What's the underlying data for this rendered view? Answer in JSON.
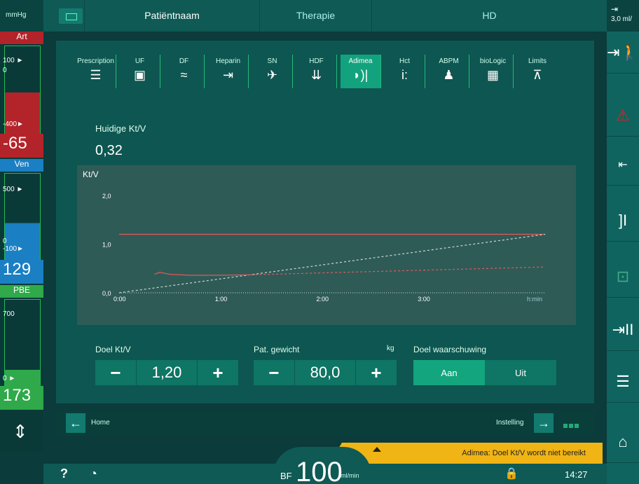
{
  "units": "mmHg",
  "top": {
    "tabs": [
      "Patiëntnaam",
      "Therapie",
      "HD"
    ],
    "right_indicator": "3,0  ml/"
  },
  "left": {
    "art": {
      "label": "Art",
      "top": "100",
      "zero": "0",
      "bottom": "-400",
      "value": "-65"
    },
    "ven": {
      "label": "Ven",
      "top": "500",
      "zero": "0",
      "bottom": "-100",
      "value": "129"
    },
    "pbe": {
      "label": "PBE",
      "top": "700",
      "zero": "0",
      "value": "173"
    }
  },
  "param_tabs": [
    "Prescription",
    "UF",
    "DF",
    "Heparin",
    "SN",
    "HDF",
    "Adimea",
    "Hct",
    "ABPM",
    "bioLogic",
    "Limits"
  ],
  "active_tab": "Adimea",
  "current_ktv": {
    "label": "Huidige Kt/V",
    "value": "0,32"
  },
  "chart_data": {
    "type": "line",
    "ylabel": "Kt/V",
    "xlabel": "h:min",
    "x_ticks": [
      "0:00",
      "1:00",
      "2:00",
      "3:00"
    ],
    "y_ticks": [
      "0,0",
      "1,0",
      "2,0"
    ],
    "xlim": [
      0,
      4
    ],
    "ylim": [
      0,
      2.3
    ],
    "series": [
      {
        "name": "target",
        "color": "#e05a5a",
        "style": "solid",
        "points": [
          [
            0,
            1.2
          ],
          [
            4.2,
            1.2
          ]
        ]
      },
      {
        "name": "reference",
        "color": "#c8d8d4",
        "style": "dashed",
        "points": [
          [
            0,
            0
          ],
          [
            4.2,
            1.2
          ]
        ]
      },
      {
        "name": "actual",
        "color": "#e05a5a",
        "style": "solid",
        "points": [
          [
            0.35,
            0.38
          ],
          [
            0.4,
            0.42
          ],
          [
            0.5,
            0.38
          ],
          [
            0.7,
            0.36
          ],
          [
            1.0,
            0.36
          ],
          [
            1.3,
            0.37
          ]
        ]
      },
      {
        "name": "prognosis",
        "color": "#e05a5a",
        "style": "dashed",
        "points": [
          [
            1.3,
            0.37
          ],
          [
            4.2,
            0.53
          ]
        ]
      }
    ]
  },
  "controls": {
    "doel": {
      "label": "Doel Kt/V",
      "value": "1,20"
    },
    "weight": {
      "label": "Pat. gewicht",
      "unit": "kg",
      "value": "80,0"
    },
    "warn": {
      "label": "Doel waarschuwing",
      "on": "Aan",
      "off": "Uit"
    }
  },
  "homebar": {
    "home": "Home",
    "instelling": "Instelling"
  },
  "warning": "Adimea: Doel Kt/V wordt niet bereikt",
  "bottom": {
    "bf_label": "BF",
    "bf_value": "100",
    "bf_unit": "ml/min",
    "time": "14:27"
  }
}
